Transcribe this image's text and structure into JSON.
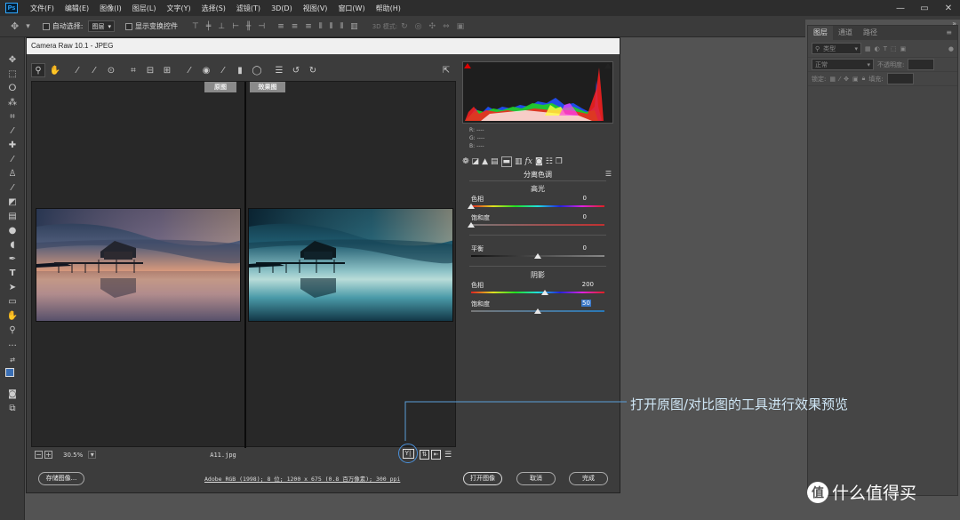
{
  "app": {
    "logo_text": "Ps",
    "menu": [
      "文件(F)",
      "编辑(E)",
      "图像(I)",
      "图层(L)",
      "文字(Y)",
      "选择(S)",
      "滤镜(T)",
      "3D(D)",
      "视图(V)",
      "窗口(W)",
      "帮助(H)"
    ],
    "window_controls": [
      "—",
      "▭",
      "✕"
    ]
  },
  "options_bar": {
    "auto_select_label": "自动选择:",
    "auto_select_target": "图层",
    "show_transform_label": "显示变换控件",
    "mode_3d_label": "3D 模式:"
  },
  "layers_panel": {
    "tabs": [
      "图层",
      "通道",
      "路径"
    ],
    "filter_label": "类型",
    "blend_mode": "正常",
    "opacity_label": "不透明度:",
    "lock_label": "锁定:",
    "fill_label": "填充:"
  },
  "dialog": {
    "title": "Camera Raw 10.1  -  JPEG",
    "before_label": "原图",
    "after_label": "效果图",
    "zoom": "30.5%",
    "filename": "A11.jpg",
    "workflow_info": "Adobe RGB (1998); 8 位; 1200 x 675 (0.8 百万像素); 300 ppi",
    "save_button": "存储图像...",
    "open_button": "打开图像",
    "cancel_button": "取消",
    "done_button": "完成"
  },
  "histogram": {
    "r_label": "R:",
    "g_label": "G:",
    "b_label": "B:",
    "r_value": "----",
    "g_value": "----",
    "b_value": "----"
  },
  "split_toning": {
    "panel_title": "分离色调",
    "highlights_title": "高光",
    "shadows_title": "阴影",
    "hue_label": "色相",
    "saturation_label": "饱和度",
    "balance_label": "平衡",
    "highlights_hue": "0",
    "highlights_saturation": "0",
    "balance": "0",
    "shadows_hue": "200",
    "shadows_saturation": "50",
    "highlights_hue_fraction": 0.0,
    "highlights_saturation_fraction": 0.0,
    "balance_fraction": 0.5,
    "shadows_hue_fraction": 0.556,
    "shadows_saturation_fraction": 0.5
  },
  "annotation": {
    "callout_text": "打开原图/对比图的工具进行效果预览",
    "watermark_text": "什么值得买",
    "watermark_icon": "值"
  },
  "colors": {
    "highlight_color": "#4a90d9",
    "callout_color": "#cfe6f5"
  }
}
